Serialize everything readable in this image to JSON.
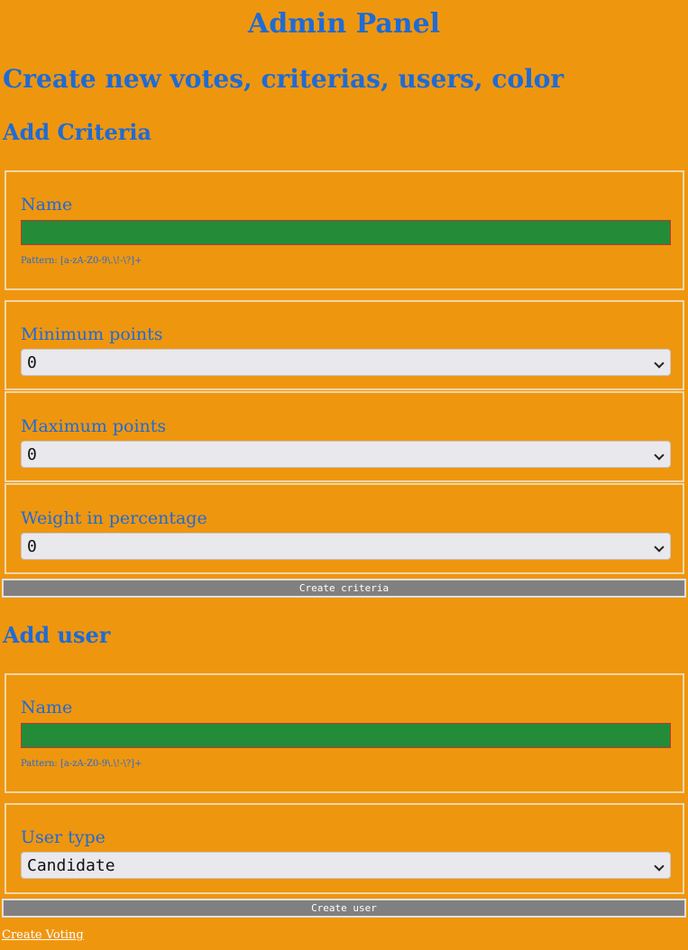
{
  "page": {
    "title": "Admin Panel",
    "subtitle": "Create new votes, criterias, users, color"
  },
  "criteria": {
    "heading": "Add Criteria",
    "name_label": "Name",
    "name_value": "",
    "pattern_hint": "Pattern: [a-zA-Z0-9\\.\\!-\\?]+",
    "min_label": "Minimum points",
    "min_value": "0",
    "max_label": "Maximum points",
    "max_value": "0",
    "weight_label": "Weight in percentage",
    "weight_value": "0",
    "submit_label": "Create criteria"
  },
  "user": {
    "heading": "Add user",
    "name_label": "Name",
    "name_value": "",
    "pattern_hint": "Pattern: [a-zA-Z0-9\\.\\!-\\?]+",
    "type_label": "User type",
    "type_value": "Candidate",
    "submit_label": "Create user"
  },
  "footer": {
    "link_label": "Create Voting"
  },
  "colors": {
    "background": "#ef960f",
    "text": "#1e6bd6",
    "input": "#248b38",
    "button": "#808080"
  },
  "icons": {
    "select_arrow": "chevron-down-icon"
  }
}
